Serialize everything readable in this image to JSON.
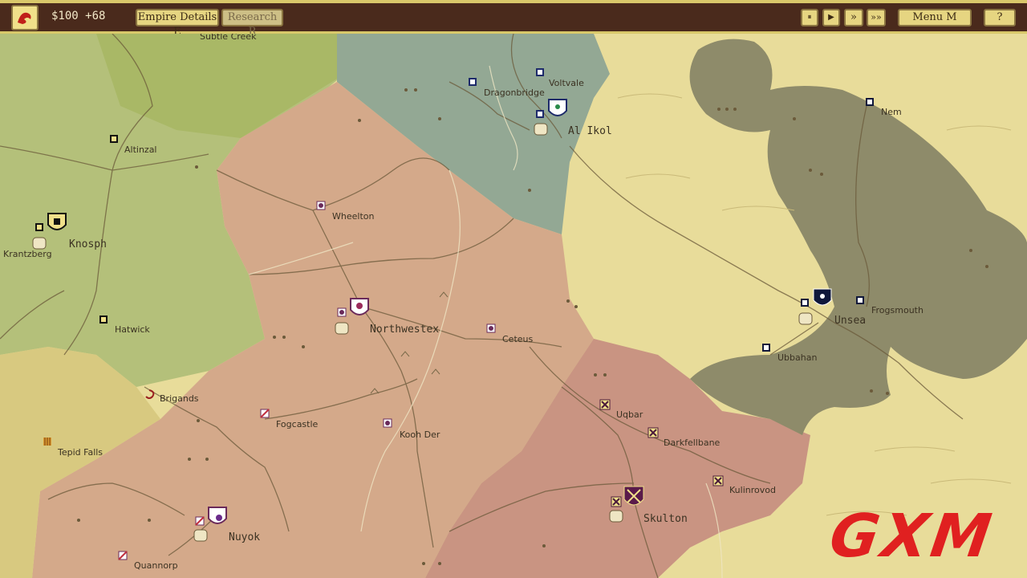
{
  "topbar": {
    "treasury": "$100 +68",
    "empire_details": "Empire Details E",
    "research": "Research R",
    "pause": "⏸",
    "play": "▶",
    "fast": "»",
    "faster": "»»",
    "menu": "Menu M",
    "help": "?"
  },
  "places": {
    "subtle_creek": "Subtle Creek",
    "dragonbridge": "Dragonbridge",
    "voltvale": "Voltvale",
    "al_ikol": "Al Ikol",
    "nem": "Nem",
    "altinzal": "Altinzal",
    "wheelton": "Wheelton",
    "knosph": "Knosph",
    "krantzberg": "Krantzberg",
    "hatwick": "Hatwick",
    "northwestex": "Northwestex",
    "ceteus": "Ceteus",
    "unsea": "Unsea",
    "frogsmouth": "Frogsmouth",
    "ubbahan": "Ubbahan",
    "brigands": "Brigands",
    "fogcastle": "Fogcastle",
    "uqbar": "Uqbar",
    "darkfellbane": "Darkfellbane",
    "kooh_der": "Kooh Der",
    "tepid_falls": "Tepid Falls",
    "kulinrovod": "Kulinrovod",
    "skulton": "Skulton",
    "nuyok": "Nuyok",
    "quannorp": "Quannorp"
  },
  "watermark": "GXM",
  "colors": {
    "sea": "#e8dc9a",
    "green_empire": "#a9b866",
    "blue_empire": "#93a894",
    "peach_empire": "#d4a98a",
    "rose_empire": "#c99482",
    "dark_empire": "#8e8b6a",
    "topbar": "#4a2a1c",
    "button": "#e6d581"
  }
}
